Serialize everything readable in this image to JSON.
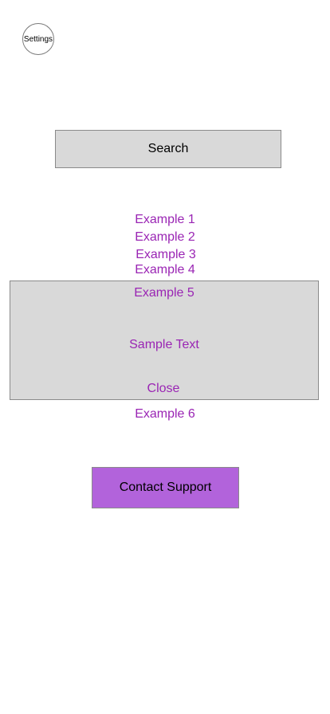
{
  "header": {
    "settings_label": "Settings"
  },
  "search": {
    "button_label": "Search"
  },
  "examples": {
    "items": [
      "Example 1",
      "Example 2",
      "Example 3",
      "Example 4",
      "Example 5",
      "Example 6"
    ]
  },
  "popup": {
    "body_text": "Sample Text",
    "close_label": "Close"
  },
  "support": {
    "button_label": "Contact Support"
  },
  "colors": {
    "link": "#9a25b4",
    "panel_gray": "#d9d9d9",
    "support_purple": "#b263db"
  }
}
